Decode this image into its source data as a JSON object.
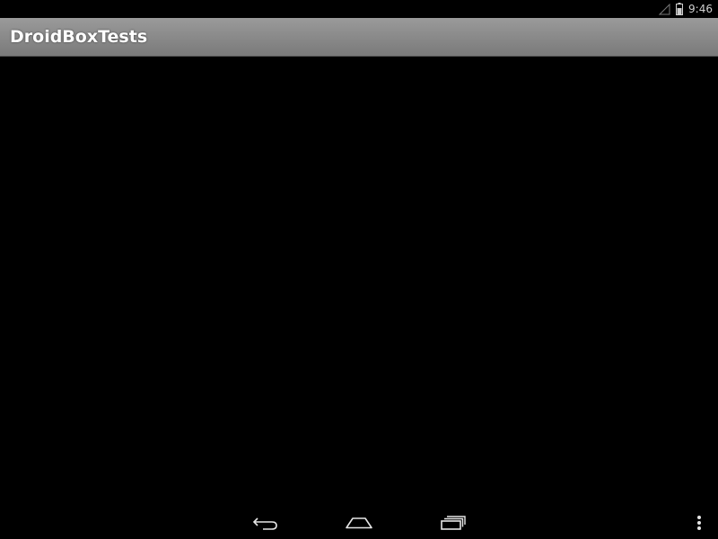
{
  "status_bar": {
    "time": "9:46",
    "signal_icon": "signal-icon",
    "battery_icon": "battery-icon"
  },
  "action_bar": {
    "title": "DroidBoxTests"
  },
  "nav_bar": {
    "back_icon": "back-icon",
    "home_icon": "home-icon",
    "recent_apps_icon": "recent-apps-icon",
    "overflow_menu_icon": "overflow-menu-icon"
  },
  "colors": {
    "background": "#000000",
    "action_bar": "#8a8a8a",
    "title_text": "#ffffff",
    "nav_icons": "#e6e6e6"
  }
}
